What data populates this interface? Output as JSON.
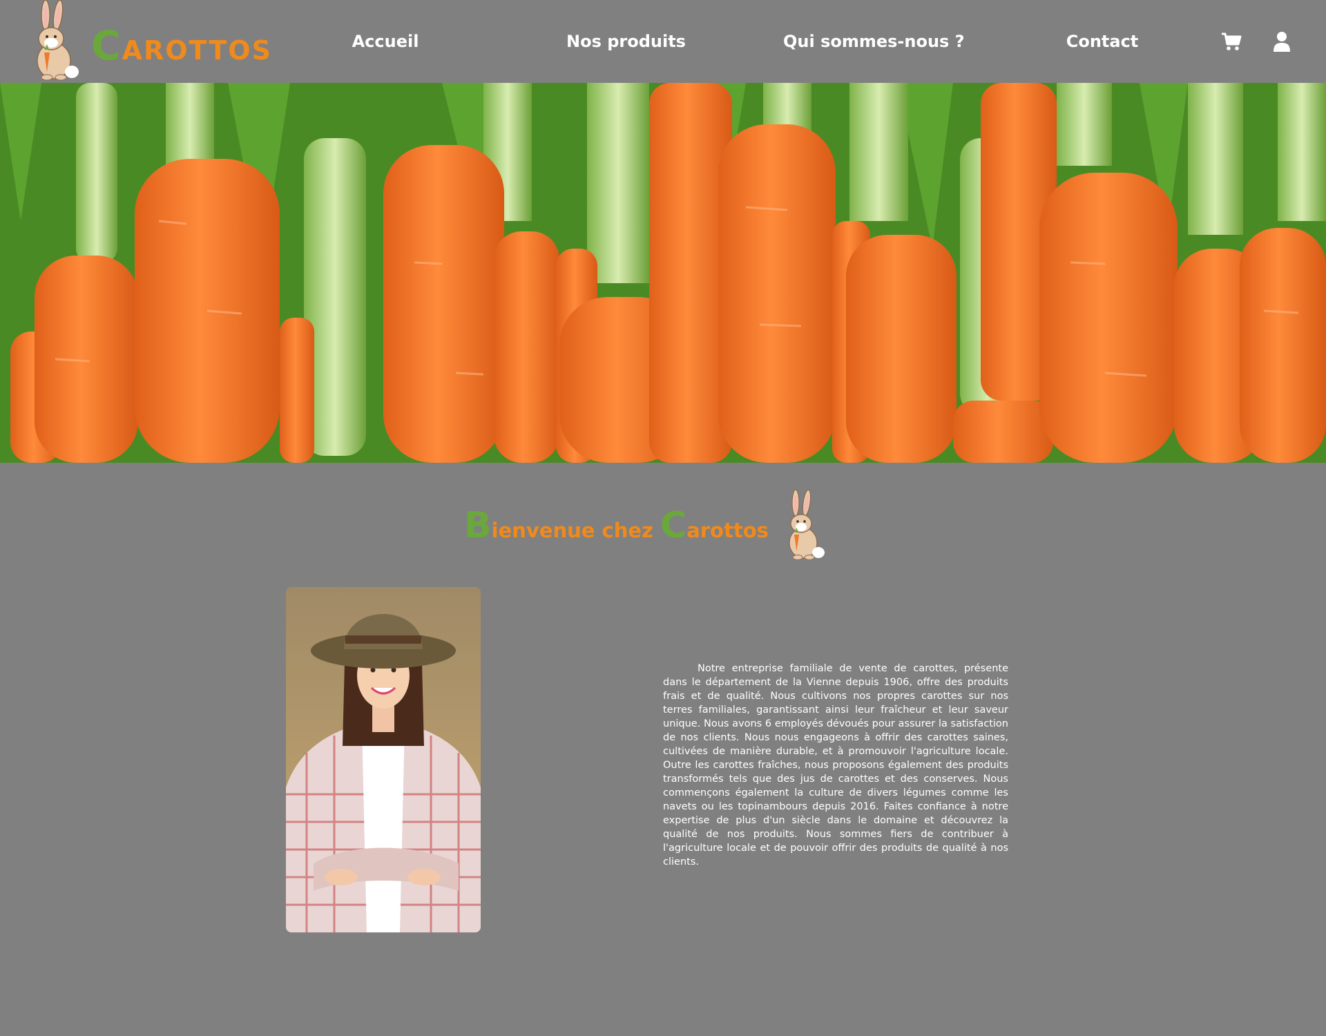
{
  "brand": {
    "initial": "C",
    "rest": "AROTTOS"
  },
  "nav": {
    "items": [
      {
        "label": "Accueil"
      },
      {
        "label": "Nos produits"
      },
      {
        "label": "Qui sommes-nous ?"
      },
      {
        "label": "Contact"
      }
    ],
    "cart_icon": "cart-icon",
    "user_icon": "user-icon"
  },
  "welcome": {
    "part1_cap": "B",
    "part1_rest": "ienvenue chez ",
    "part2_cap": "C",
    "part2_rest": "arottos"
  },
  "about": {
    "text": "Notre entreprise familiale de vente de carottes, présente dans le département de la Vienne depuis 1906, offre des produits frais et de qualité. Nous cultivons nos propres carottes sur nos terres familiales, garantissant ainsi leur fraîcheur et leur saveur unique. Nous avons 6 employés dévoués pour assurer la satisfaction de nos clients. Nous nous engageons à offrir des carottes saines, cultivées de manière durable, et à promouvoir l'agriculture locale. Outre les carottes fraîches, nous proposons également des produits transformés tels que des jus de carottes et des conserves. Nous commençons également la culture de divers légumes comme les navets ou les topinambours depuis 2016. Faites confiance à notre expertise de plus d'un siècle dans le domaine et découvrez la qualité de nos produits. Nous sommes fiers de contribuer à l'agriculture locale et de pouvoir offrir des produits de qualité à nos clients."
  },
  "colors": {
    "background": "#808080",
    "brand_orange": "#f08a1c",
    "brand_green": "#6aa83c",
    "carrot": "#f07a2a",
    "text": "#ffffff"
  }
}
